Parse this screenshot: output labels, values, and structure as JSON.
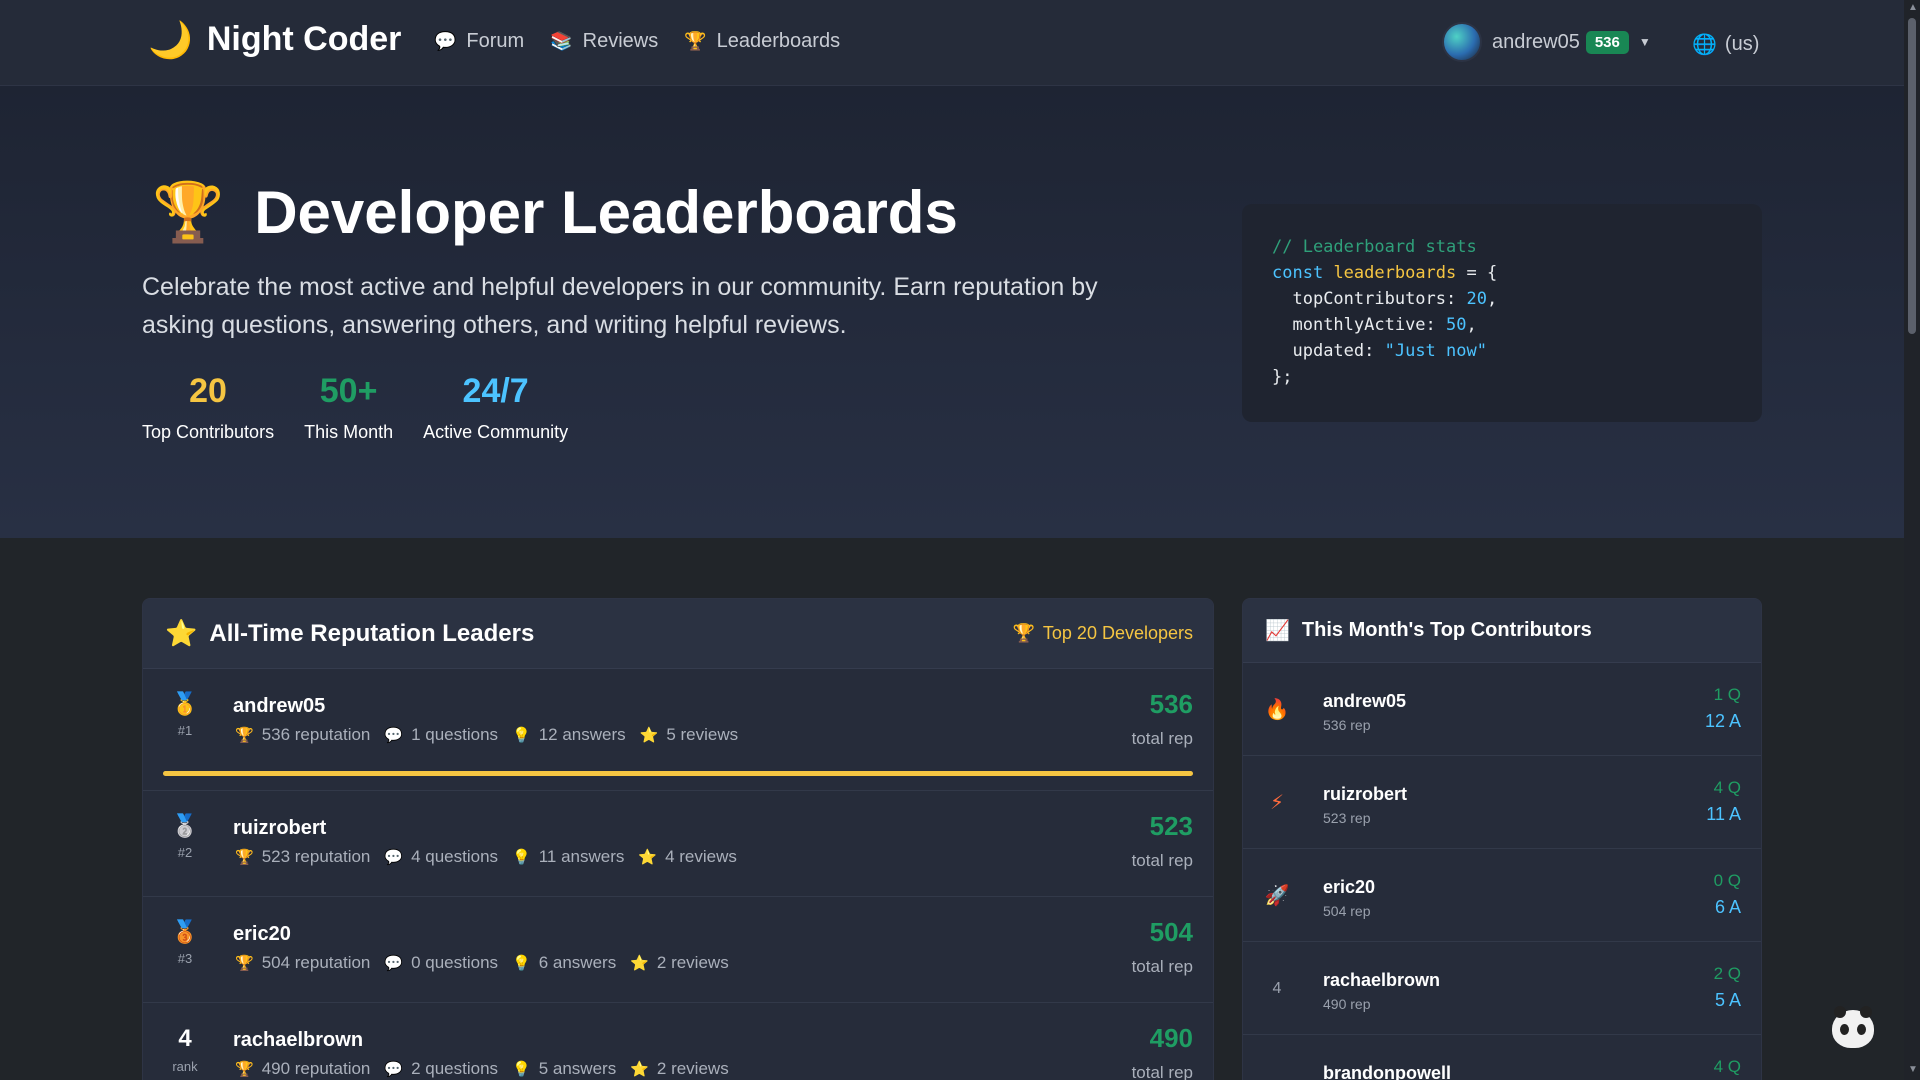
{
  "nav": {
    "brand": "Night Coder",
    "links": [
      {
        "label": "Forum",
        "icon": "speech-bubble-icon"
      },
      {
        "label": "Reviews",
        "icon": "books-icon"
      },
      {
        "label": "Leaderboards",
        "icon": "trophy-icon"
      }
    ],
    "user": {
      "name": "andrew05",
      "rep": "536"
    },
    "language": "(us)"
  },
  "hero": {
    "title": "Developer Leaderboards",
    "description": "Celebrate the most active and helpful developers in our community. Earn reputation by asking questions, answering others, and writing helpful reviews.",
    "stats": [
      {
        "value": "20",
        "label": "Top Contributors",
        "color": "#f5c542"
      },
      {
        "value": "50+",
        "label": "This Month",
        "color": "#1f9d63"
      },
      {
        "value": "24/7",
        "label": "Active Community",
        "color": "#4cc3ff"
      }
    ],
    "code": {
      "comment": "// Leaderboard stats",
      "kw": "const",
      "var": "leaderboards",
      "eq": " = {",
      "top_key": "topContributors: ",
      "top_val": "20",
      "monthly_key": "monthlyActive: ",
      "monthly_val": "50",
      "updated_key": "updated: ",
      "updated_val": "\"Just now\"",
      "close": "};"
    }
  },
  "alltime": {
    "title": "All-Time Reputation Leaders",
    "badge": "Top 20 Developers",
    "rows": [
      {
        "rank": "#1",
        "name": "andrew05",
        "rep": "536 reputation",
        "questions": "1 questions",
        "answers": "12 answers",
        "reviews": "5 reviews",
        "score": "536",
        "score_label": "total rep",
        "progress": 1.0
      },
      {
        "rank": "#2",
        "name": "ruizrobert",
        "rep": "523 reputation",
        "questions": "4 questions",
        "answers": "11 answers",
        "reviews": "4 reviews",
        "score": "523",
        "score_label": "total rep"
      },
      {
        "rank": "#3",
        "name": "eric20",
        "rep": "504 reputation",
        "questions": "0 questions",
        "answers": "6 answers",
        "reviews": "2 reviews",
        "score": "504",
        "score_label": "total rep"
      },
      {
        "rank_num": "4",
        "rank": "rank",
        "name": "rachaelbrown",
        "rep": "490 reputation",
        "questions": "2 questions",
        "answers": "5 answers",
        "reviews": "2 reviews",
        "score": "490",
        "score_label": "total rep"
      }
    ]
  },
  "monthly": {
    "title": "This Month's Top Contributors",
    "rows": [
      {
        "name": "andrew05",
        "rep": "536 rep",
        "q": "1 Q",
        "a": "12 A"
      },
      {
        "name": "ruizrobert",
        "rep": "523 rep",
        "q": "4 Q",
        "a": "11 A"
      },
      {
        "name": "eric20",
        "rep": "504 rep",
        "q": "0 Q",
        "a": "6 A"
      },
      {
        "rank": "4",
        "name": "rachaelbrown",
        "rep": "490 rep",
        "q": "2 Q",
        "a": "5 A"
      },
      {
        "name": "brandonpowell",
        "q": "4 Q"
      }
    ]
  }
}
